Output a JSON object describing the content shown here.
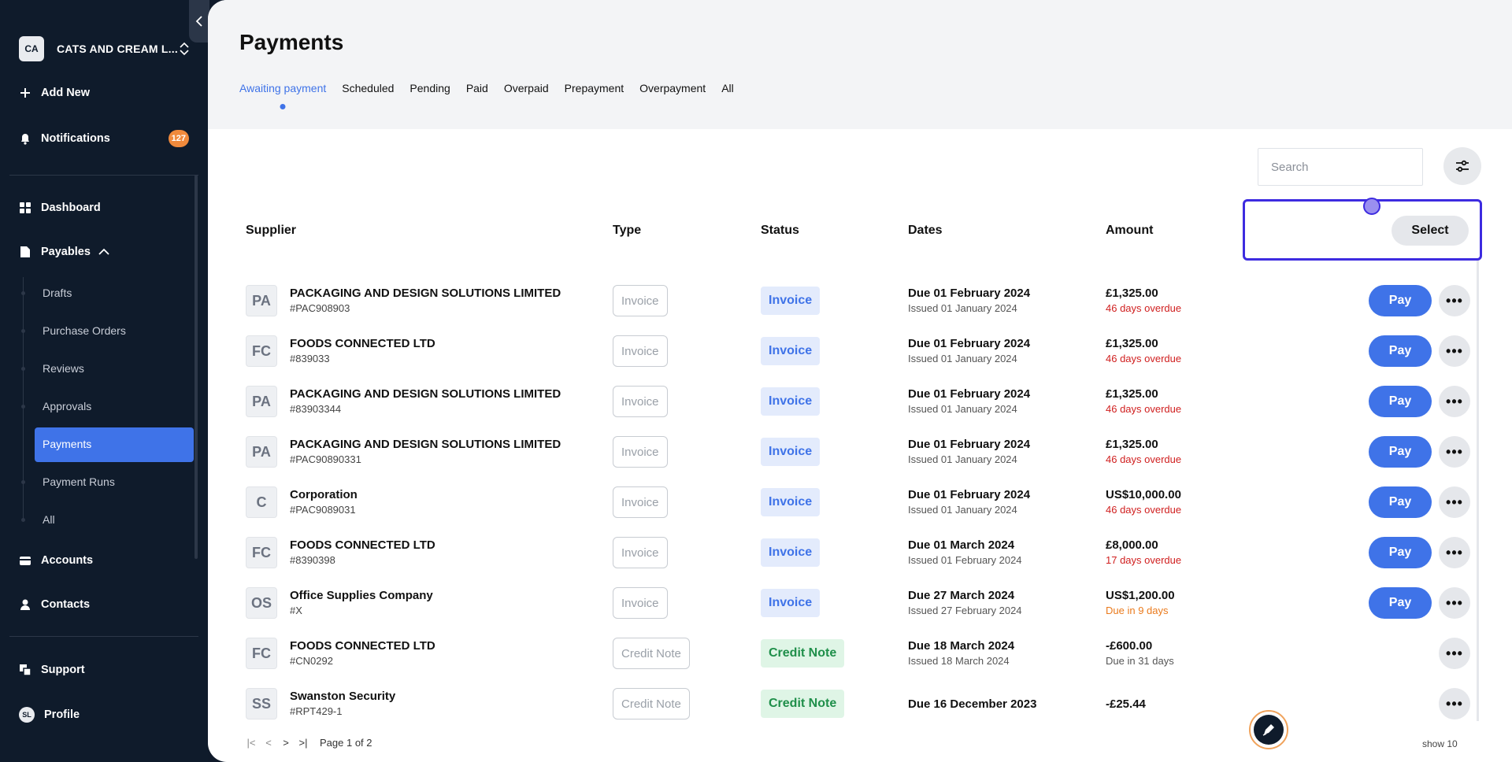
{
  "sidebar": {
    "org_initials": "CA",
    "org_name": "CATS AND CREAM L...",
    "add_new": "Add New",
    "notifications": "Notifications",
    "notifications_count": "127",
    "dashboard": "Dashboard",
    "payables": "Payables",
    "sub_items": [
      "Drafts",
      "Purchase Orders",
      "Reviews",
      "Approvals",
      "Payments",
      "Payment Runs",
      "All"
    ],
    "active_sub_item": "Payments",
    "accounts": "Accounts",
    "contacts": "Contacts",
    "support": "Support",
    "profile": "Profile",
    "profile_initials": "SL"
  },
  "header": {
    "title": "Payments",
    "tabs": [
      "Awaiting payment",
      "Scheduled",
      "Pending",
      "Paid",
      "Overpaid",
      "Prepayment",
      "Overpayment",
      "All"
    ],
    "active_tab": "Awaiting payment"
  },
  "search": {
    "placeholder": "Search"
  },
  "table": {
    "columns": [
      "Supplier",
      "Type",
      "Status",
      "Dates",
      "Amount"
    ],
    "select_label": "Select",
    "rows": [
      {
        "initials": "PA",
        "name": "PACKAGING AND DESIGN SOLUTIONS LIMITED",
        "ref": "#PAC908903",
        "type": "Invoice",
        "status": "Invoice",
        "due": "Due 01 February 2024",
        "issued": "Issued 01 January 2024",
        "amount": "£1,325.00",
        "note": "46 days overdue",
        "note_kind": "overdue",
        "pay": "Pay"
      },
      {
        "initials": "FC",
        "name": "FOODS CONNECTED LTD",
        "ref": "#839033",
        "type": "Invoice",
        "status": "Invoice",
        "due": "Due 01 February 2024",
        "issued": "Issued 01 January 2024",
        "amount": "£1,325.00",
        "note": "46 days overdue",
        "note_kind": "overdue",
        "pay": "Pay"
      },
      {
        "initials": "PA",
        "name": "PACKAGING AND DESIGN SOLUTIONS LIMITED",
        "ref": "#83903344",
        "type": "Invoice",
        "status": "Invoice",
        "due": "Due 01 February 2024",
        "issued": "Issued 01 January 2024",
        "amount": "£1,325.00",
        "note": "46 days overdue",
        "note_kind": "overdue",
        "pay": "Pay"
      },
      {
        "initials": "PA",
        "name": "PACKAGING AND DESIGN SOLUTIONS LIMITED",
        "ref": "#PAC90890331",
        "type": "Invoice",
        "status": "Invoice",
        "due": "Due 01 February 2024",
        "issued": "Issued 01 January 2024",
        "amount": "£1,325.00",
        "note": "46 days overdue",
        "note_kind": "overdue",
        "pay": "Pay"
      },
      {
        "initials": "C",
        "name": "Corporation",
        "ref": "#PAC9089031",
        "type": "Invoice",
        "status": "Invoice",
        "due": "Due 01 February 2024",
        "issued": "Issued 01 January 2024",
        "amount": "US$10,000.00",
        "note": "46 days overdue",
        "note_kind": "overdue",
        "pay": "Pay"
      },
      {
        "initials": "FC",
        "name": "FOODS CONNECTED LTD",
        "ref": "#8390398",
        "type": "Invoice",
        "status": "Invoice",
        "due": "Due 01 March 2024",
        "issued": "Issued 01 February 2024",
        "amount": "£8,000.00",
        "note": "17 days overdue",
        "note_kind": "overdue",
        "pay": "Pay"
      },
      {
        "initials": "OS",
        "name": "Office Supplies Company",
        "ref": "#X",
        "type": "Invoice",
        "status": "Invoice",
        "due": "Due 27 March 2024",
        "issued": "Issued 27 February 2024",
        "amount": "US$1,200.00",
        "note": "Due in 9 days",
        "note_kind": "soon",
        "pay": "Pay"
      },
      {
        "initials": "FC",
        "name": "FOODS CONNECTED LTD",
        "ref": "#CN0292",
        "type": "Credit Note",
        "status": "Credit Note",
        "due": "Due 18 March 2024",
        "issued": "Issued 18 March 2024",
        "amount": "-£600.00",
        "note": "Due in 31 days",
        "note_kind": "normal",
        "pay": ""
      },
      {
        "initials": "SS",
        "name": "Swanston Security",
        "ref": "#RPT429-1",
        "type": "Credit Note",
        "status": "Credit Note",
        "due": "Due 16 December 2023",
        "issued": "",
        "amount": "-£25.44",
        "note": "",
        "note_kind": "normal",
        "pay": ""
      }
    ]
  },
  "pager": {
    "label": "Page 1 of 2",
    "show": "show 10"
  },
  "colors": {
    "accent": "#3f73e8",
    "sidebar_bg": "#0f1b2b",
    "overdue": "#d01f1f",
    "soon": "#ea7a1c",
    "credit": "#1f8f4a",
    "highlight": "#3d2be0"
  }
}
